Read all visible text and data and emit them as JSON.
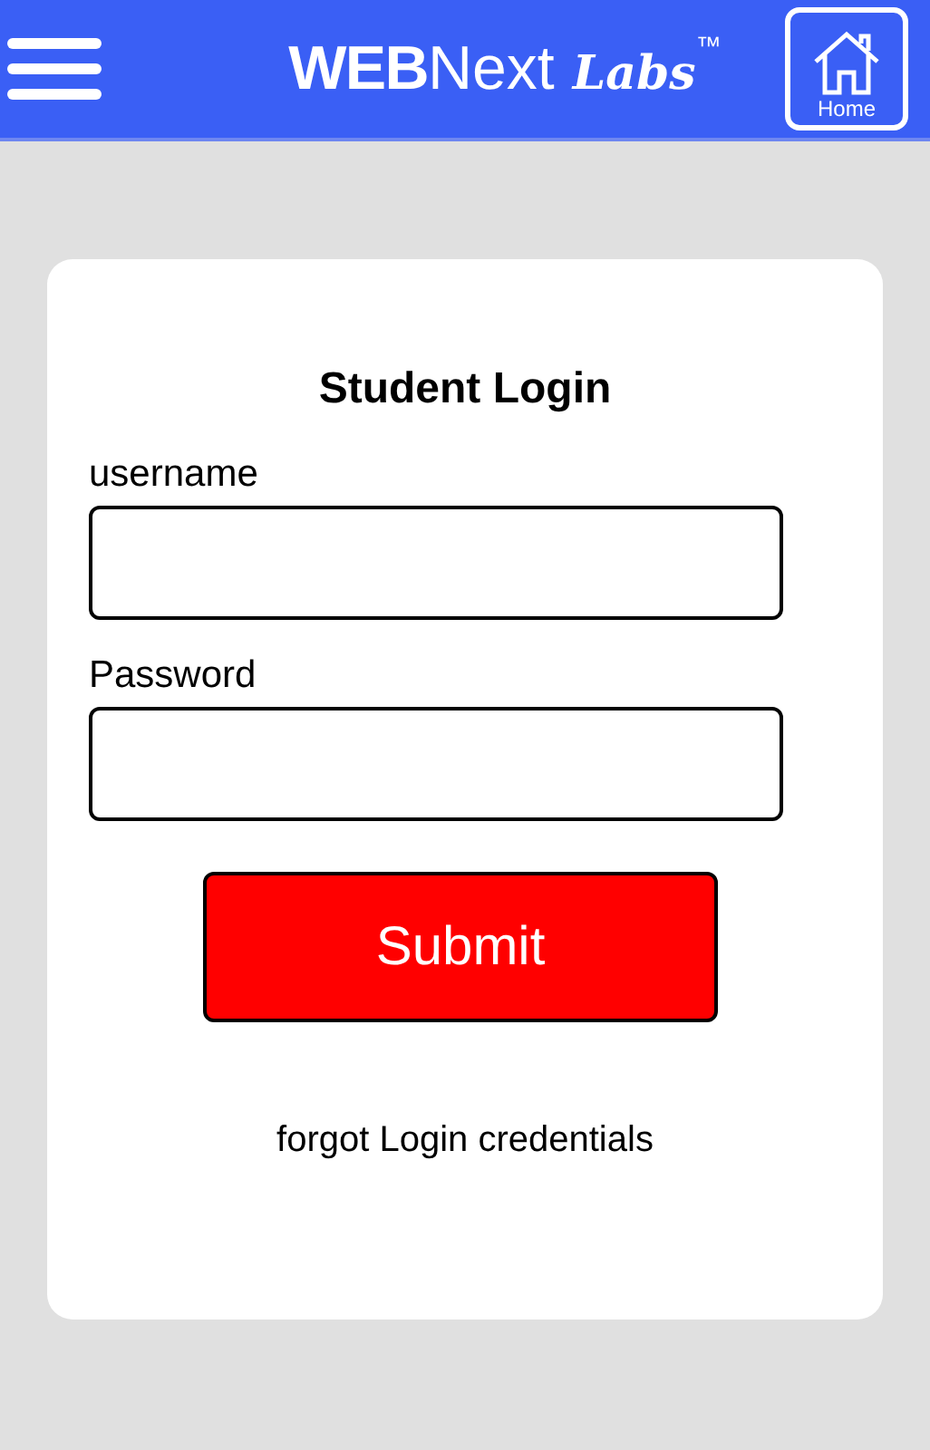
{
  "header": {
    "logo": {
      "bold": "WEB",
      "light": "Next",
      "script": "Labs",
      "mark": "™"
    },
    "home_button": "Home"
  },
  "login": {
    "title": "Student Login",
    "fields": [
      {
        "label": "username"
      },
      {
        "label": "Password"
      }
    ],
    "submit": "Submit",
    "forgot_link": "forgot Login credentials"
  }
}
